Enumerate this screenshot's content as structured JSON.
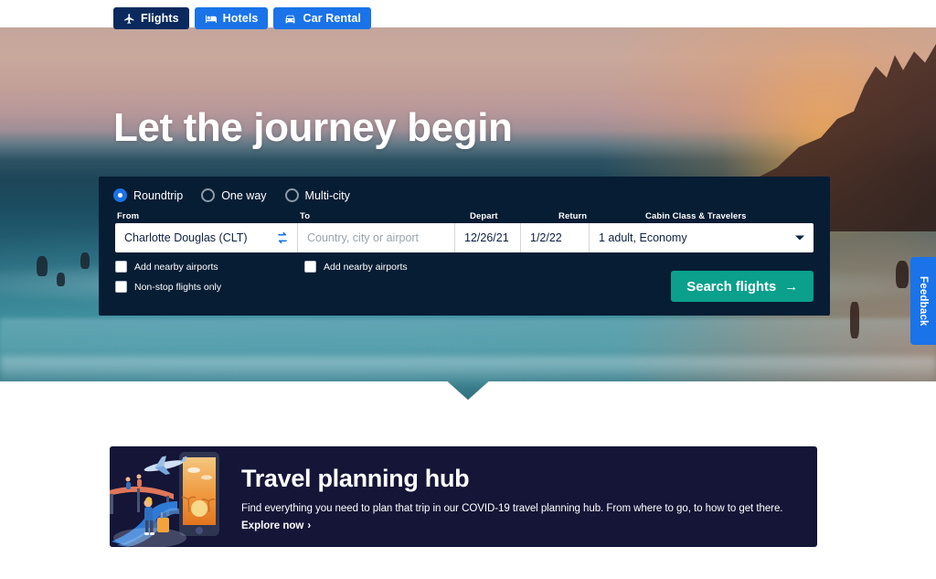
{
  "tabbar": {
    "tabs": [
      {
        "label": "Flights",
        "icon": "airplane-icon",
        "active": true
      },
      {
        "label": "Hotels",
        "icon": "bed-icon",
        "active": false
      },
      {
        "label": "Car Rental",
        "icon": "car-icon",
        "active": false
      }
    ]
  },
  "hero": {
    "title": "Let the journey begin"
  },
  "search": {
    "trip_types": [
      {
        "label": "Roundtrip",
        "selected": true
      },
      {
        "label": "One way",
        "selected": false
      },
      {
        "label": "Multi-city",
        "selected": false
      }
    ],
    "labels": {
      "from": "From",
      "to": "To",
      "depart": "Depart",
      "return": "Return",
      "cabin": "Cabin Class & Travelers"
    },
    "values": {
      "from": "Charlotte Douglas (CLT)",
      "to": "",
      "depart": "12/26/21",
      "return": "1/2/22",
      "cabin": "1 adult, Economy"
    },
    "placeholders": {
      "from": "Country, city or airport",
      "to": "Country, city or airport"
    },
    "checkboxes": {
      "from_nearby": "Add nearby airports",
      "to_nearby": "Add nearby airports",
      "nonstop": "Non-stop flights only"
    },
    "submit_label": "Search flights",
    "submit_arrow": "→",
    "swap_icon": "swap-arrows-icon",
    "cabin_caret": "chevron-down-icon",
    "accent_color": "#0aa08c",
    "panel_color": "#071d34"
  },
  "feedback": {
    "label": "Feedback",
    "color": "#1a73e8"
  },
  "hub": {
    "title": "Travel planning hub",
    "description": "Find everything you need to plan that trip in our COVID-19 travel planning hub. From where to go, to how to get there.",
    "link_label": "Explore now",
    "link_arrow": "›",
    "card_color": "#141537",
    "illustration": "travel-planning-illustration"
  }
}
